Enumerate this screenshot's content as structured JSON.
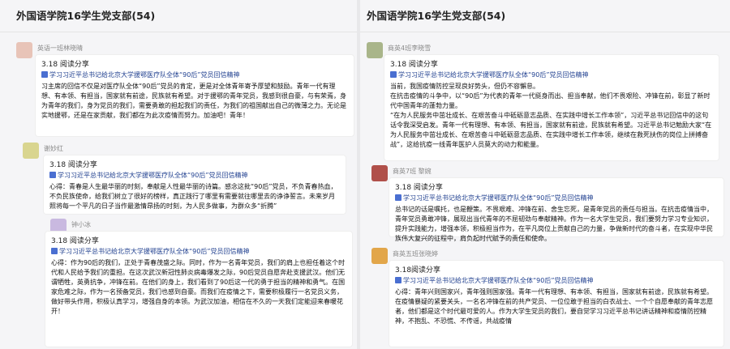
{
  "left": {
    "title": "外国语学院16学生党支部(54)",
    "posts": [
      {
        "name": "英语一班林晓晴",
        "share_label": "3.18 阅读分享",
        "link_title": "学习习近平总书记给北京大学援鄂医疗队全体“90后”党员回信精神",
        "body": "习主席的回信不仅是对医疗队全体“90后”党员的肯定，更是对全体青年寄予厚望和鼓励。青年一代有理想、有本领、有担当，国家就有前途，民族就有希望。对于援鄂的青年党员，我感到很自豪，与有荣焉，身为青年的我们，身为党员的我们，需要勇敢的担起我们的责任，为我们的祖国献出自己的微薄之力。无论是实地援鄂，还是在家贡献，我们都在为此次疫情而努力。加油吧！青年！"
      },
      {
        "name": "谢妙红",
        "share_label": "3.18 阅读分享",
        "link_title": "学习习近平总书记给北京大学援鄂医疗队全体“90后”党员回信精神",
        "body": "心得：青春是人生最华丽的时刻，奉献是人性最华丽的诗篇。感念这批“90后”党员，不负青春热血，不负民族使命，给我们树立了很好的榜样，真正践行了哪里有需要就往哪里去的诤诤誓言。未来岁月照将每一个平凡的日子当作最激情昂扬的时刻，为人民多做事，为群众多“折腾”"
      },
      {
        "name": "钟小冰",
        "share_label": "3.18 阅读分享",
        "link_title": "学习习近平总书记给北京大学援鄂医疗队全体“90后”党员回信精神",
        "body": "心得：作为90后的我们，正处于青春茂盛之际。同时，作为一名青年党员，我们的肩上也担任着这个时代和人民给予我们的重担。在这次武汉新冠性肺炎病毒爆发之际，90后党员自愿奔赴支援武汉。他们无谓牺牲，英勇抗争，冲锋在前。在他们的身上，我们看到了90后这一代的勇于担当的精神和勇气。在国家危难之际，作为一名预备党员，我们也感到自豪。而我们在疫情之下，需要积极履行一名党员义务，做好带头作用，积极认真学习，增强自身的本领。为武汉加油，相信在不久的一天我们定能迎来春暖花开！"
      }
    ]
  },
  "right": {
    "title": "外国语学院16学生党支部(54)",
    "posts": [
      {
        "name": "商英4班李晓雪",
        "share_label": "3.18 阅读分享",
        "link_title": "学习习近平总书记给北京大学援鄂医疗队全体“90后”党员回信精神",
        "body": "当前，我国疫情防控呈现良好势头，但仍不容懈怠。\n在抗击疫情的斗争中，以“90后”为代表的青年一代挺身而出、担当奉献，他们不畏艰险、冲锋在前，彰显了新时代中国青年的蓬勃力量。\n“在为人民服务中茁壮成长、在艰苦奋斗中砥砺意志品质、在实践中增长工作本领”，习近平总书记回信中的这句话令我深受启发。青年一代有理想、有本领、有担当，国家就有前途，民族就有希望。习近平总书记勉励大家“在为人民服务中茁壮成长、在艰苦奋斗中砥砺意志品质、在实践中增长工作本领，继续在救死扶伤的岗位上拼搏奋战”，这给抗疫一线青年医护人员莫大的动力和能量。"
      },
      {
        "name": "商英7班 黎婉",
        "share_label": "3.18 阅读分享",
        "link_title": "学习习近平总书记给北京大学援鄂医疗队全体“90后”党员回信精神",
        "body": "总书记的话是嘱托，也是鞭策。不畏艰难、冲锋在前、舍生忘死，是青年党员的责任与担当。在抗击疫情当中，青年党员勇敢冲锋，展现出当代青年的不屈韧劲与奉献精神。作为一名大学生党员，我们要努力学习专业知识，提升实践能力，增强本领，积极担当作为，在平凡岗位上贡献自己的力量，争做新时代的奋斗者，在实现中华民族伟大复兴的征程中，肩负起时代赋予的责任和使命。"
      },
      {
        "name": "商英五班张晓婷",
        "share_label": "3.18阅读分享",
        "link_title": "学习习近平总书记给北京大学援鄂医疗队全体“90后”党员回信精神",
        "body": "心得：青年兴则国家兴，青年强则国家强。青年一代有理想、有本领、有担当，国家就有前途，民族就有希望。在疫情暴疑的紧要关头，一名名冲锋在前的共产党员、一位位敢于担当的白衣战士、一个个自愿奉献的青年志愿者，他们都是这个时代最可爱的人。作为大学生党员的我们，要自觉学习习近平总书记讲话精神和疫情防控精神，不抱乱、不恐慌、不传谣，共战疫情"
      }
    ]
  },
  "colors": {
    "panel_bg": "#f5f5f7",
    "card_bg": "#ffffff",
    "link_blue": "#1f3f8f"
  }
}
